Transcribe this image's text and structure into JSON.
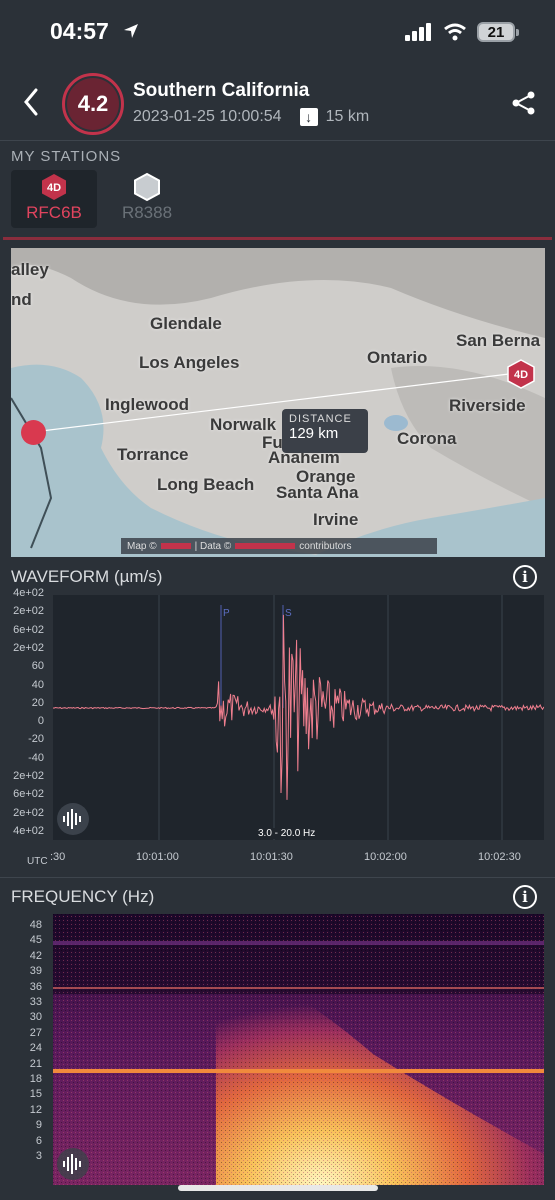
{
  "status_bar": {
    "time": "04:57",
    "battery": "21"
  },
  "header": {
    "magnitude": "4.2",
    "title": "Southern California",
    "datetime": "2023-01-25 10:00:54",
    "depth": "15 km"
  },
  "stations": {
    "label": "MY STATIONS",
    "items": [
      {
        "badge": "4D",
        "name": "RFC6B",
        "active": true
      },
      {
        "badge": "",
        "name": "R8388",
        "active": false
      }
    ]
  },
  "map": {
    "places": [
      "alley",
      "nd",
      "Glendale",
      "Los Angeles",
      "Ontario",
      "San Berna",
      "Inglewood",
      "Norwalk",
      "Fu",
      "Anaheim",
      "Riverside",
      "Corona",
      "Torrance",
      "Orange",
      "Long Beach",
      "Santa Ana",
      "Irvine"
    ],
    "station_badge": "4D",
    "distance_label": "DISTANCE",
    "distance_value": "129 km",
    "attribution_map": "Map ©",
    "attribution_data": "| Data ©",
    "attribution_contrib": "contributors"
  },
  "waveform": {
    "title": "WAVEFORM (µm/s)",
    "y_ticks": [
      "4e+02",
      "2e+02",
      "6e+02",
      "2e+02",
      "60",
      "40",
      "20",
      "0",
      "-20",
      "-40",
      "2e+02",
      "6e+02",
      "2e+02",
      "4e+02"
    ],
    "x_ticks": [
      ":30",
      "10:01:00",
      "10:01:30",
      "10:02:00",
      "10:02:30"
    ],
    "utc_label": "UTC",
    "filter_label": "3.0 - 20.0 Hz",
    "p_marker": "P",
    "s_marker": "S"
  },
  "frequency": {
    "title": "FREQUENCY (Hz)",
    "y_ticks": [
      "48",
      "45",
      "42",
      "39",
      "36",
      "33",
      "30",
      "27",
      "24",
      "21",
      "18",
      "15",
      "12",
      "9",
      "6",
      "3"
    ]
  },
  "colors": {
    "accent": "#c2334b",
    "wave": "#f07f8f",
    "bg": "#2b3138",
    "chart": "#1f252c"
  }
}
